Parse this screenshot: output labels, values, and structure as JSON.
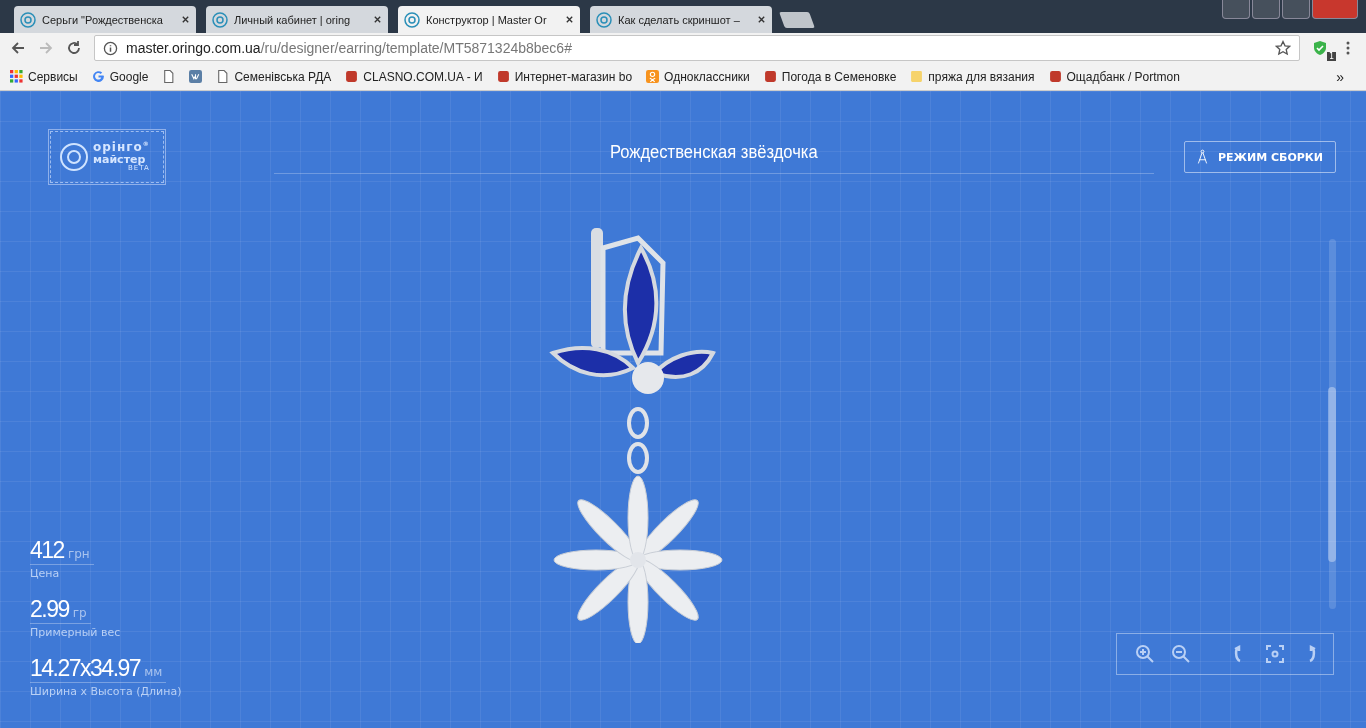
{
  "tabs": [
    {
      "title": "Серьги \"Рождественска",
      "selected": false
    },
    {
      "title": "Личный кабинет | oring",
      "selected": false
    },
    {
      "title": "Конструктор | Master Or",
      "selected": true
    },
    {
      "title": "Как сделать скриншот –",
      "selected": false
    }
  ],
  "address": {
    "host": "master.oringo.com.ua",
    "path": "/ru/designer/earring/template/MT5871324b8bec6#"
  },
  "extension_badge": "1",
  "bookmarks": [
    {
      "kind": "apps",
      "label": "Сервисы"
    },
    {
      "kind": "google",
      "label": "Google"
    },
    {
      "kind": "page"
    },
    {
      "kind": "vk"
    },
    {
      "kind": "page",
      "label": "Семенівська РДА"
    },
    {
      "kind": "site",
      "label": "CLASNO.COM.UA - И"
    },
    {
      "kind": "site",
      "label": "Интернет-магазин bo"
    },
    {
      "kind": "ok",
      "label": "Одноклассники"
    },
    {
      "kind": "site",
      "label": "Погода в Семеновке"
    },
    {
      "kind": "folder",
      "label": "пряжа для вязания"
    },
    {
      "kind": "site",
      "label": "Ощадбанк / Portmon"
    }
  ],
  "bookmarks_more": "»",
  "logo": {
    "line1": "орінго",
    "line2": "майстер",
    "beta": "BETA",
    "mark": "®"
  },
  "title": "Рождественская звёздочка",
  "assembly_button": "РЕЖИМ СБОРКИ",
  "stats": [
    {
      "value": "412",
      "unit": "грн",
      "label": "Цена"
    },
    {
      "value": "2.99",
      "unit": "гр",
      "label": "Примерный вес"
    },
    {
      "value": "14.27x34.97",
      "unit": "мм",
      "label": "Ширина х Высота (Длина)"
    }
  ]
}
